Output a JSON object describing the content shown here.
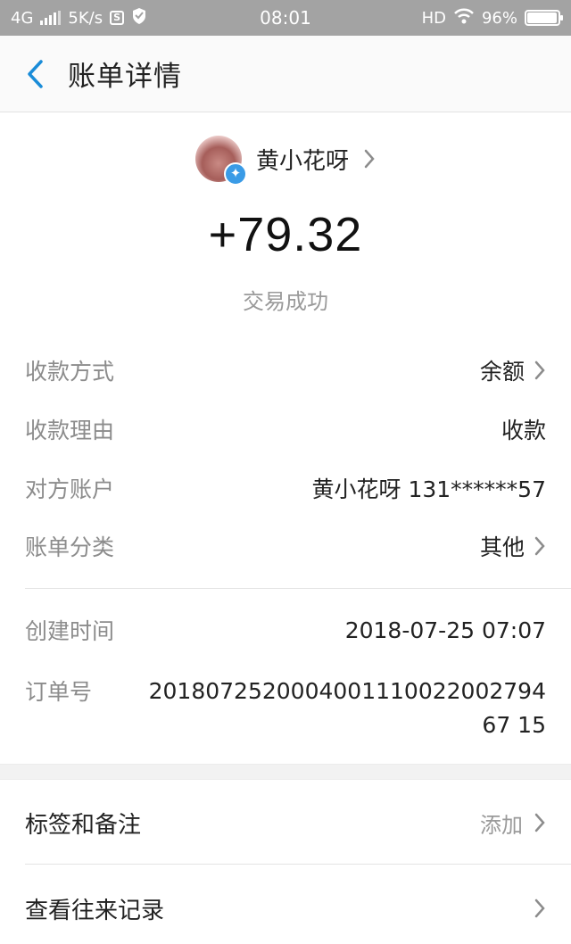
{
  "statusbar": {
    "network": "4G",
    "speed": "5K/s",
    "time": "08:01",
    "hd": "HD",
    "battery": "96%",
    "battery_level": 0.96
  },
  "header": {
    "title": "账单详情",
    "back_icon": "chevron-left-icon",
    "accent": "#1a8cd8"
  },
  "payer": {
    "name": "黄小花呀",
    "badge_icon": "verified-icon"
  },
  "transaction": {
    "amount": "+79.32",
    "status": "交易成功"
  },
  "details": [
    {
      "label": "收款方式",
      "value": "余额",
      "chevron": true
    },
    {
      "label": "收款理由",
      "value": "收款",
      "chevron": false
    },
    {
      "label": "对方账户",
      "value": "黄小花呀 131******57",
      "chevron": false
    },
    {
      "label": "账单分类",
      "value": "其他",
      "chevron": true
    }
  ],
  "meta": {
    "created_label": "创建时间",
    "created_value": "2018-07-25 07:07",
    "order_label": "订单号",
    "order_value": "201807252000400111002200279467 15"
  },
  "actions": {
    "tags_label": "标签和备注",
    "tags_value": "添加",
    "history_label": "查看往来记录"
  }
}
